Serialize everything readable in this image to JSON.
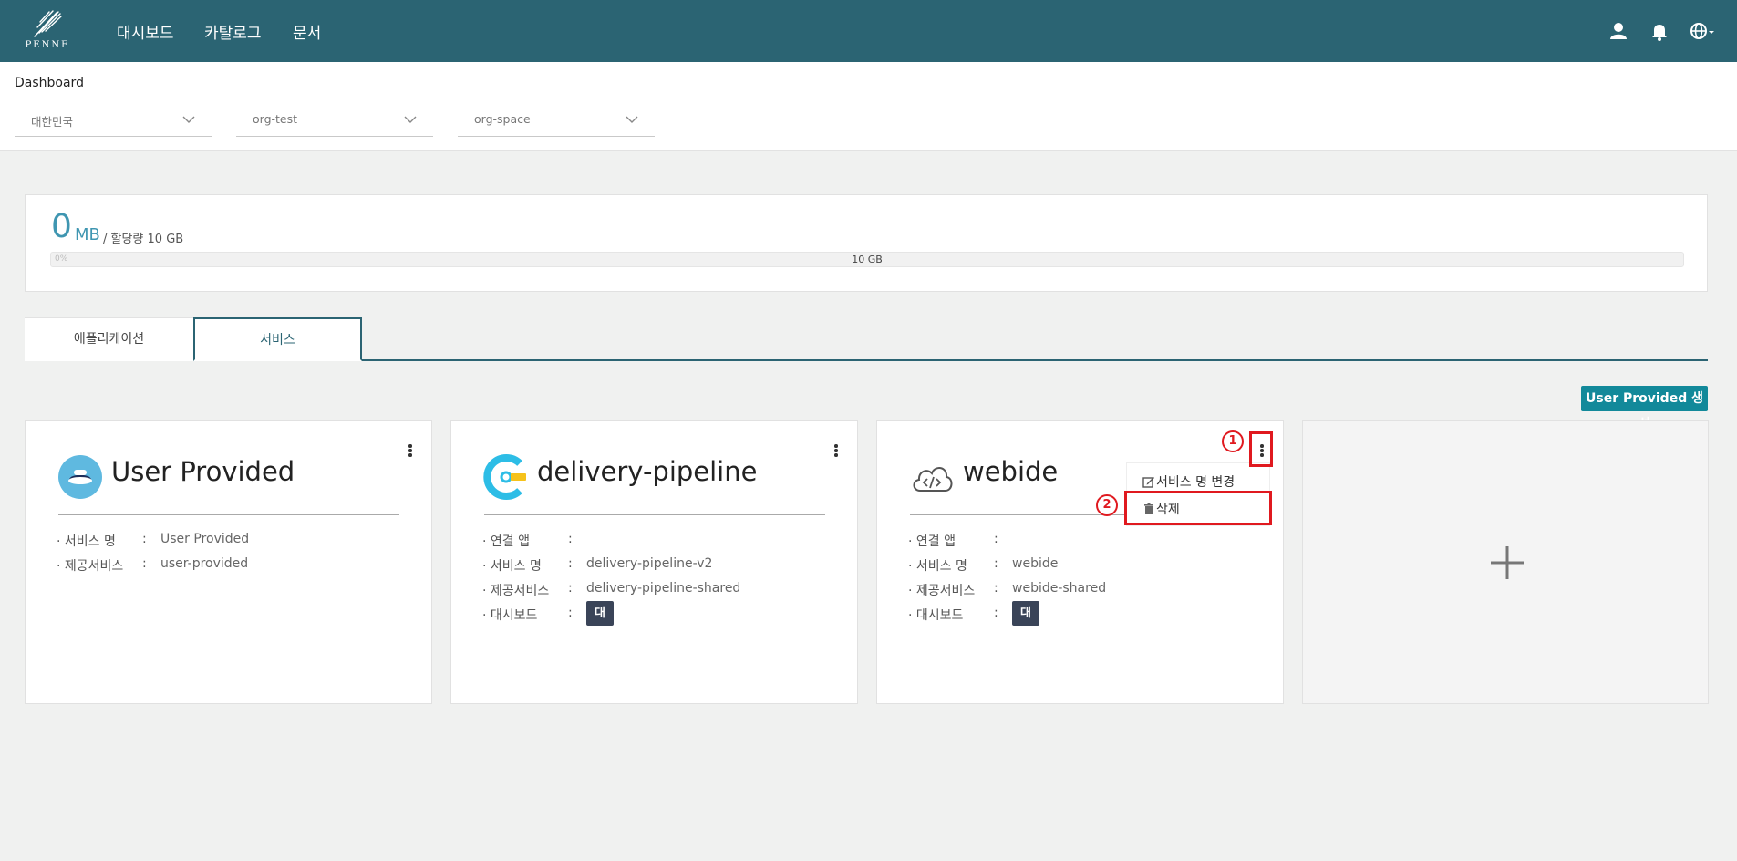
{
  "brand": {
    "name": "PENNE"
  },
  "nav": [
    "대시보드",
    "카탈로그",
    "문서"
  ],
  "top_icons": [
    "user-icon",
    "bell-icon",
    "globe-icon"
  ],
  "header": {
    "breadcrumb": "Dashboard",
    "selects": [
      {
        "value": "대한민국"
      },
      {
        "value": "org-test"
      },
      {
        "value": "org-space"
      }
    ]
  },
  "usage": {
    "used": "0",
    "unit": "MB",
    "quota": "/ 할당량 10 GB",
    "bar_percent_label": "0%",
    "bar_label": "10 GB",
    "percent_used": 0
  },
  "tabs": [
    {
      "label": "애플리케이션",
      "active": false
    },
    {
      "label": "서비스",
      "active": true
    }
  ],
  "create_button": "User Provided 생성",
  "cards": [
    {
      "title": "User Provided",
      "icon": "user-provided-icon",
      "rows": [
        {
          "key": "· 서비스 명",
          "value": "User Provided"
        },
        {
          "key": "· 제공서비스",
          "value": "user-provided"
        }
      ]
    },
    {
      "title": "delivery-pipeline",
      "icon": "delivery-pipeline-icon",
      "rows": [
        {
          "key": "· 연결 앱",
          "value": ""
        },
        {
          "key": "· 서비스 명",
          "value": "delivery-pipeline-v2"
        },
        {
          "key": "· 제공서비스",
          "value": "delivery-pipeline-shared"
        },
        {
          "key": "· 대시보드",
          "button": "대시보드"
        }
      ]
    },
    {
      "title": "webide",
      "icon": "webide-cloud-icon",
      "rows": [
        {
          "key": "· 연결 앱",
          "value": ""
        },
        {
          "key": "· 서비스 명",
          "value": "webide"
        },
        {
          "key": "· 제공서비스",
          "value": "webide-shared"
        },
        {
          "key": "· 대시보드",
          "button": "대시보드"
        }
      ]
    }
  ],
  "separator": ":",
  "dropdown": {
    "rename": "서비스 명 변경",
    "delete": "삭제"
  },
  "annotations": {
    "step1": "1",
    "step2": "2",
    "color": "#e0191f"
  },
  "colors": {
    "topbar": "#2b6473",
    "accent": "#12899a",
    "usage": "#3f96b1",
    "dashboard_button": "#3a4458"
  }
}
